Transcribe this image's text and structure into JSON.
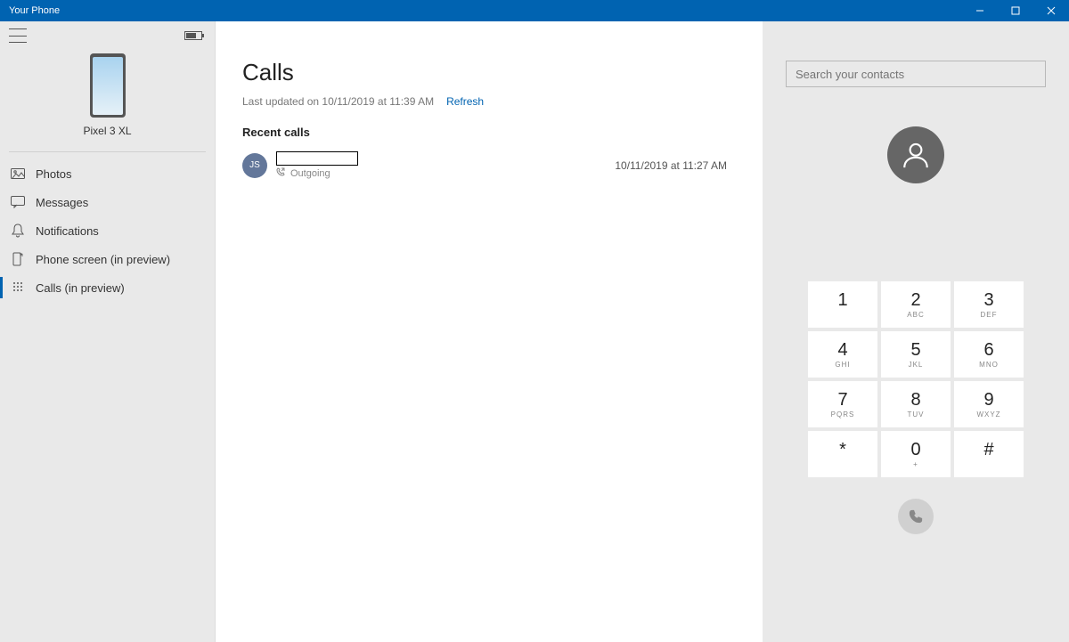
{
  "window": {
    "title": "Your Phone"
  },
  "sidebar": {
    "device_name": "Pixel 3 XL",
    "items": [
      {
        "label": "Photos"
      },
      {
        "label": "Messages"
      },
      {
        "label": "Notifications"
      },
      {
        "label": "Phone screen (in preview)"
      },
      {
        "label": "Calls (in preview)"
      }
    ]
  },
  "main": {
    "title": "Calls",
    "last_updated": "Last updated on 10/11/2019 at 11:39 AM",
    "refresh_label": "Refresh",
    "section_header": "Recent calls",
    "calls": [
      {
        "initials": "JS",
        "direction_label": "Outgoing",
        "timestamp": "10/11/2019 at 11:27 AM"
      }
    ]
  },
  "dialer": {
    "search_placeholder": "Search your contacts",
    "keys": [
      {
        "num": "1",
        "let": ""
      },
      {
        "num": "2",
        "let": "ABC"
      },
      {
        "num": "3",
        "let": "DEF"
      },
      {
        "num": "4",
        "let": "GHI"
      },
      {
        "num": "5",
        "let": "JKL"
      },
      {
        "num": "6",
        "let": "MNO"
      },
      {
        "num": "7",
        "let": "PQRS"
      },
      {
        "num": "8",
        "let": "TUV"
      },
      {
        "num": "9",
        "let": "WXYZ"
      },
      {
        "num": "*",
        "let": ""
      },
      {
        "num": "0",
        "let": "+"
      },
      {
        "num": "#",
        "let": ""
      }
    ]
  }
}
